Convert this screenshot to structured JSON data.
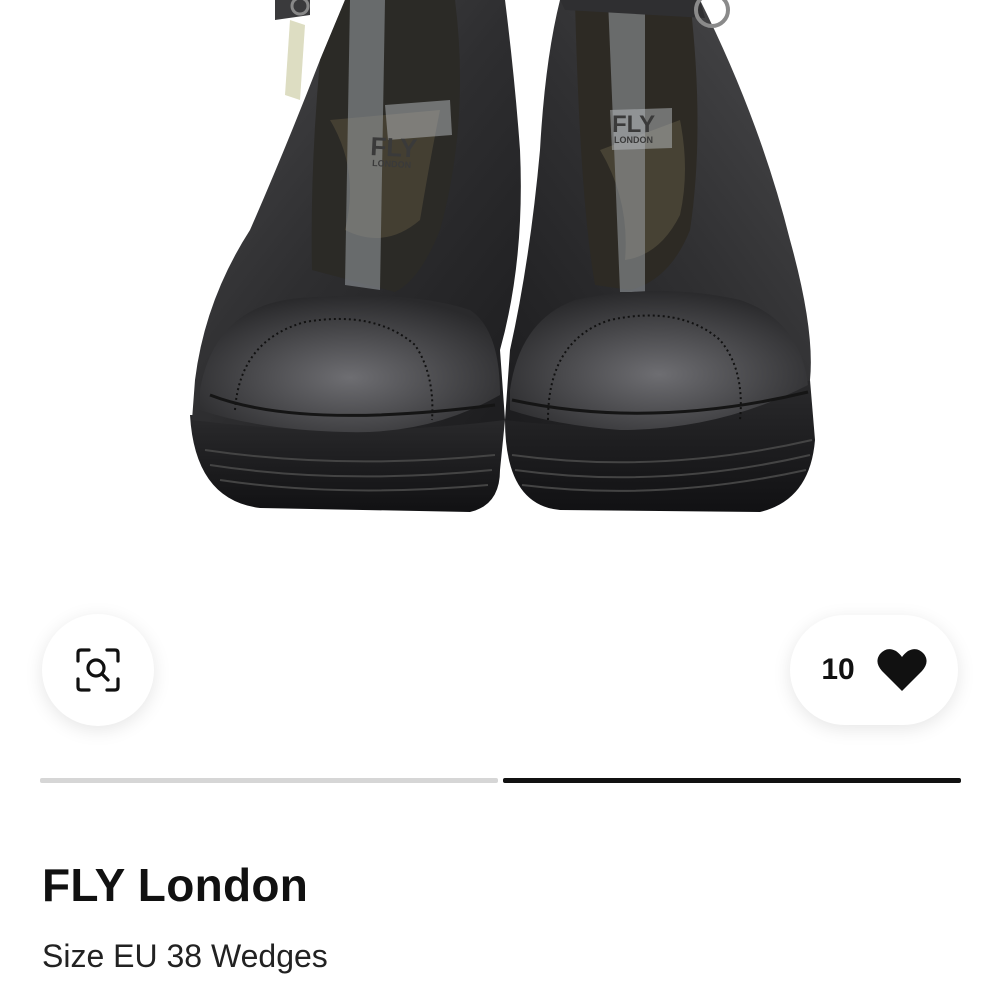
{
  "product": {
    "brand": "FLY London",
    "subtitle": "Size EU 38 Wedges",
    "insole_logo_text": "FLY",
    "insole_logo_sub": "LONDON"
  },
  "actions": {
    "favorites_count": "10",
    "zoom_icon": "zoom-search-icon",
    "heart_icon": "heart-icon"
  },
  "gallery": {
    "current_image": 2,
    "total_images": 2
  },
  "colors": {
    "progress_inactive": "#d6d6d6",
    "progress_active": "#111111",
    "text": "#111111"
  }
}
